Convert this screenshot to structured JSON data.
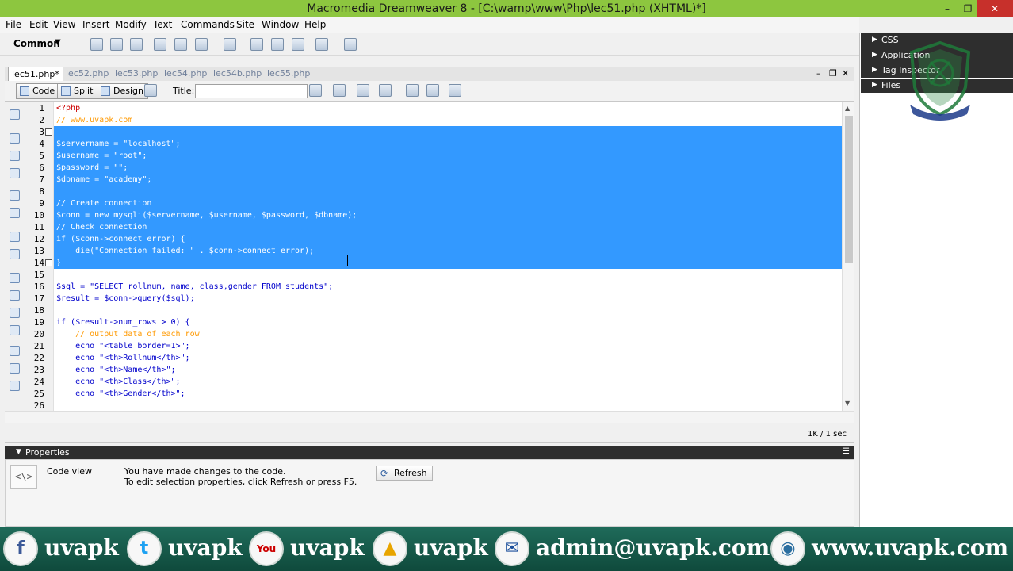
{
  "window": {
    "title": "Macromedia Dreamweaver 8 - [C:\\wamp\\www\\Php\\lec51.php (XHTML)*]",
    "controls": [
      "–",
      "❐",
      "✕"
    ]
  },
  "menu": [
    "File",
    "Edit",
    "View",
    "Insert",
    "Modify",
    "Text",
    "Commands",
    "Site",
    "Window",
    "Help"
  ],
  "insert_bar": {
    "category": "Common",
    "caret": "▼"
  },
  "panels": [
    {
      "label": "CSS",
      "tri": "▶"
    },
    {
      "label": "Application",
      "tri": "▶"
    },
    {
      "label": "Tag Inspector",
      "tri": "▶"
    },
    {
      "label": "Files",
      "tri": "▶"
    }
  ],
  "tabs": [
    "lec51.php*",
    "lec52.php",
    "lec53.php",
    "lec54.php",
    "lec54b.php",
    "lec55.php"
  ],
  "doc_controls": [
    "–",
    "❐",
    "✕"
  ],
  "doc_toolbar": {
    "code": "Code",
    "split": "Split",
    "design": "Design",
    "title_label": "Title:",
    "title_value": ""
  },
  "code": {
    "lines": [
      {
        "n": "1",
        "text": "<?php",
        "cls": "c-php"
      },
      {
        "n": "2",
        "text": "// www.uvapk.com",
        "cls": "c-cmt"
      },
      {
        "n": "3",
        "text": "",
        "cls": ""
      },
      {
        "n": "4",
        "text": "$servername = \"localhost\";",
        "cls": "sel"
      },
      {
        "n": "5",
        "text": "$username = \"root\";",
        "cls": "sel"
      },
      {
        "n": "6",
        "text": "$password = \"\";",
        "cls": "sel"
      },
      {
        "n": "7",
        "text": "$dbname = \"academy\";",
        "cls": "sel"
      },
      {
        "n": "8",
        "text": "",
        "cls": "sel"
      },
      {
        "n": "9",
        "text": "// Create connection",
        "cls": "sel"
      },
      {
        "n": "10",
        "text": "$conn = new mysqli($servername, $username, $password, $dbname);",
        "cls": "sel"
      },
      {
        "n": "11",
        "text": "// Check connection",
        "cls": "sel"
      },
      {
        "n": "12",
        "text": "if ($conn->connect_error) {",
        "cls": "sel"
      },
      {
        "n": "13",
        "text": "    die(\"Connection failed: \" . $conn->connect_error);",
        "cls": "sel"
      },
      {
        "n": "14",
        "text": "}",
        "cls": "sel"
      },
      {
        "n": "15",
        "text": "",
        "cls": ""
      },
      {
        "n": "16",
        "text": "$sql = \"SELECT rollnum, name, class,gender FROM students\";",
        "cls": "c-var"
      },
      {
        "n": "17",
        "text": "$result = $conn->query($sql);",
        "cls": "c-var"
      },
      {
        "n": "18",
        "text": "",
        "cls": ""
      },
      {
        "n": "19",
        "text": "if ($result->num_rows > 0) {",
        "cls": "c-var"
      },
      {
        "n": "20",
        "text": "    // output data of each row",
        "cls": "c-cmt"
      },
      {
        "n": "21",
        "text": "    echo \"<table border=1>\";",
        "cls": "c-var"
      },
      {
        "n": "22",
        "text": "    echo \"<th>Rollnum</th>\";",
        "cls": "c-var"
      },
      {
        "n": "23",
        "text": "    echo \"<th>Name</th>\";",
        "cls": "c-var"
      },
      {
        "n": "24",
        "text": "    echo \"<th>Class</th>\";",
        "cls": "c-var"
      },
      {
        "n": "25",
        "text": "    echo \"<th>Gender</th>\";",
        "cls": "c-var"
      },
      {
        "n": "26",
        "text": "",
        "cls": ""
      }
    ]
  },
  "status": {
    "size_time": "1K / 1 sec"
  },
  "properties": {
    "header": "Properties",
    "view_label": "Code view",
    "msg1": "You have made changes to the code.",
    "msg2": "To edit selection properties, click Refresh or press F5.",
    "refresh": "Refresh",
    "code_icon": "<\\>"
  },
  "banner": [
    {
      "icon": "f",
      "icon_name": "facebook-icon",
      "text": "uvapk",
      "color": "#3b5998"
    },
    {
      "icon": "t",
      "icon_name": "twitter-icon",
      "text": "uvapk",
      "color": "#1da1f2"
    },
    {
      "icon": "You",
      "icon_name": "youtube-icon",
      "text": "uvapk",
      "color": "#cc0000"
    },
    {
      "icon": "▲",
      "icon_name": "drive-icon",
      "text": "uvapk",
      "color": "#e8a500"
    },
    {
      "icon": "✉",
      "icon_name": "mail-icon",
      "text": "admin@uvapk.com",
      "color": "#1c4f9c"
    },
    {
      "icon": "◉",
      "icon_name": "web-icon",
      "text": "www.uvapk.com",
      "color": "#2b6ea0"
    }
  ],
  "colors": {
    "titlebar": "#8dc63f",
    "selection": "#3399ff",
    "banner": "#1f6b5a"
  }
}
